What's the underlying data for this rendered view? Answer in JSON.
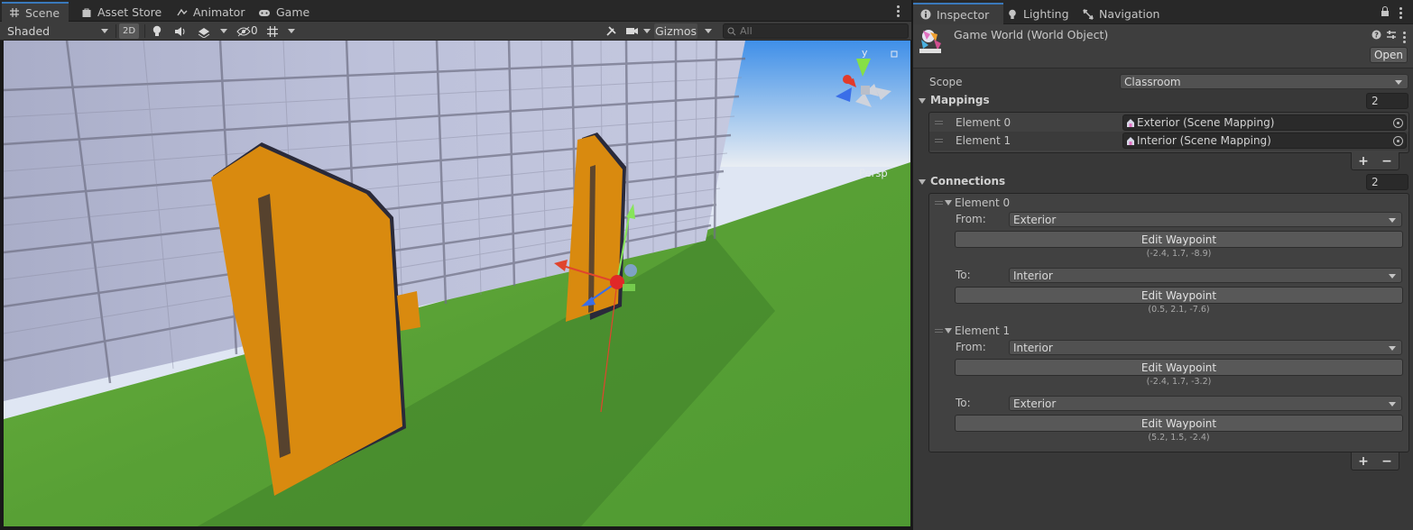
{
  "scene_tabs": [
    {
      "label": "Scene",
      "icon": "grid-icon"
    },
    {
      "label": "Asset Store",
      "icon": "bag-icon"
    },
    {
      "label": "Animator",
      "icon": "animator-icon"
    },
    {
      "label": "Game",
      "icon": "gamepad-icon"
    }
  ],
  "scene_toolbar": {
    "shading_mode": "Shaded",
    "mode_2d": "2D",
    "hidden_count": "0",
    "gizmos_label": "Gizmos",
    "search_placeholder": "All"
  },
  "viewport": {
    "projection_label": "Persp",
    "gizmo_axis_label": "y"
  },
  "inspector_tabs": [
    {
      "label": "Inspector",
      "icon": "info-icon"
    },
    {
      "label": "Lighting",
      "icon": "bulb-icon"
    },
    {
      "label": "Navigation",
      "icon": "navigation-icon"
    }
  ],
  "inspector": {
    "object_title": "Game World (World Object)",
    "open_label": "Open",
    "scope_label": "Scope",
    "scope_value": "Classroom",
    "mappings_label": "Mappings",
    "mappings_count": "2",
    "mappings": [
      {
        "label": "Element 0",
        "value": "Exterior (Scene Mapping)"
      },
      {
        "label": "Element 1",
        "value": "Interior (Scene Mapping)"
      }
    ],
    "connections_label": "Connections",
    "connections_count": "2",
    "from_label": "From:",
    "to_label": "To:",
    "edit_waypoint_label": "Edit Waypoint",
    "connections": [
      {
        "label": "Element 0",
        "from": "Exterior",
        "from_coord": "(-2.4, 1.7, -8.9)",
        "to": "Interior",
        "to_coord": "(0.5, 2.1, -7.6)"
      },
      {
        "label": "Element 1",
        "from": "Interior",
        "from_coord": "(-2.4, 1.7, -3.2)",
        "to": "Exterior",
        "to_coord": "(5.2, 1.5, -2.4)"
      }
    ],
    "add_symbol": "+",
    "remove_symbol": "−"
  },
  "colors": {
    "door": "#d98a0f",
    "wall": "#b9bdd6",
    "grass": "#5aa03a",
    "sky_top": "#4a96e6",
    "accent_tab": "#3a79bb"
  }
}
